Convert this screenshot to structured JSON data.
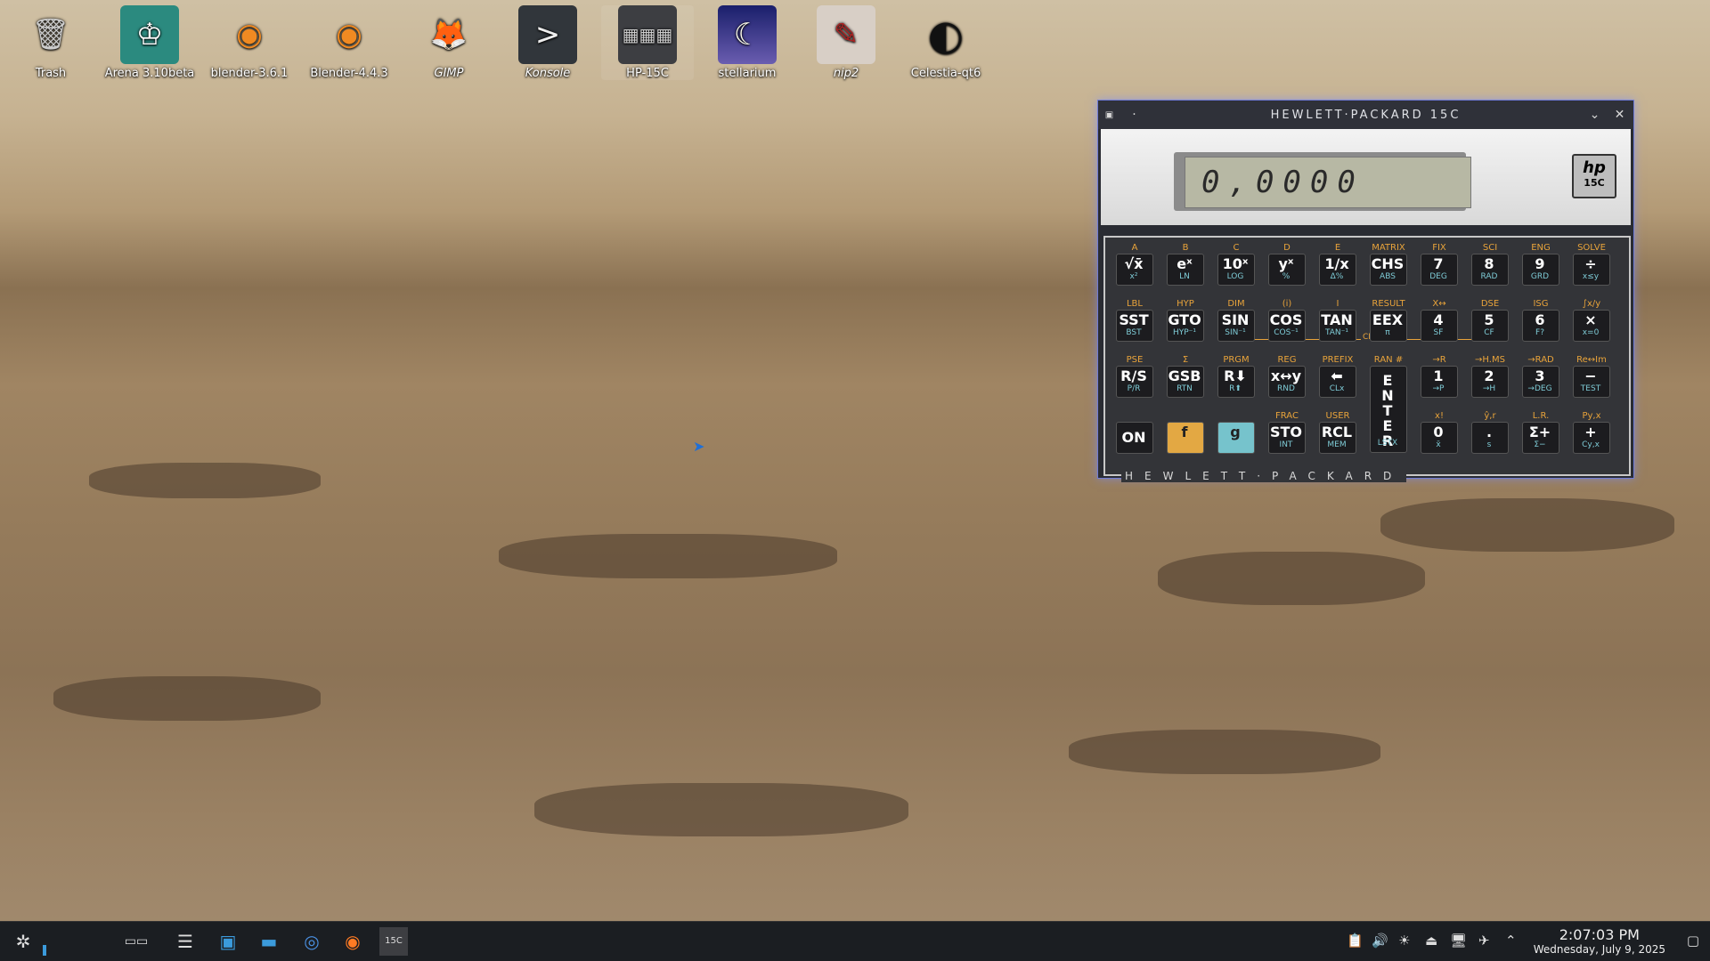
{
  "desktop": {
    "icons": [
      {
        "label": "Trash",
        "icon": "trash-icon"
      },
      {
        "label": "Arena 3.10beta",
        "icon": "chess-king-icon"
      },
      {
        "label": "blender-3.6.1",
        "icon": "blender-icon"
      },
      {
        "label": "Blender-4.4.3",
        "icon": "blender-icon"
      },
      {
        "label": "GIMP",
        "icon": "gimp-icon"
      },
      {
        "label": "Konsole",
        "icon": "terminal-icon"
      },
      {
        "label": "HP-15C",
        "icon": "calculator-icon"
      },
      {
        "label": "stellarium",
        "icon": "moon-icon"
      },
      {
        "label": "nip2",
        "icon": "image-editor-icon"
      },
      {
        "label": "Celestia-qt6",
        "icon": "celestia-icon"
      }
    ]
  },
  "window": {
    "title": "HEWLETT·PACKARD 15C",
    "display": "0,0000",
    "badge_logo": "hp",
    "badge_model": "15C",
    "brand": "HEWLETT·PACKARD"
  },
  "keys": [
    {
      "gold": "A",
      "main": "√x̄",
      "blue": "x²"
    },
    {
      "gold": "B",
      "main": "eˣ",
      "blue": "LN"
    },
    {
      "gold": "C",
      "main": "10ˣ",
      "blue": "LOG"
    },
    {
      "gold": "D",
      "main": "yˣ",
      "blue": "%"
    },
    {
      "gold": "E",
      "main": "1/x",
      "blue": "Δ%"
    },
    {
      "gold": "MATRIX",
      "main": "CHS",
      "blue": "ABS"
    },
    {
      "gold": "FIX",
      "main": "7",
      "blue": "DEG"
    },
    {
      "gold": "SCI",
      "main": "8",
      "blue": "RAD"
    },
    {
      "gold": "ENG",
      "main": "9",
      "blue": "GRD"
    },
    {
      "gold": "SOLVE",
      "main": "÷",
      "blue": "x≤y"
    },
    {
      "gold": "LBL",
      "main": "SST",
      "blue": "BST"
    },
    {
      "gold": "HYP",
      "main": "GTO",
      "blue": "HYP⁻¹"
    },
    {
      "gold": "DIM",
      "main": "SIN",
      "blue": "SIN⁻¹"
    },
    {
      "gold": "(i)",
      "main": "COS",
      "blue": "COS⁻¹"
    },
    {
      "gold": "I",
      "main": "TAN",
      "blue": "TAN⁻¹"
    },
    {
      "gold": "RESULT",
      "main": "EEX",
      "blue": "π"
    },
    {
      "gold": "X↔",
      "main": "4",
      "blue": "SF"
    },
    {
      "gold": "DSE",
      "main": "5",
      "blue": "CF"
    },
    {
      "gold": "ISG",
      "main": "6",
      "blue": "F?"
    },
    {
      "gold": "∫x/y",
      "main": "×",
      "blue": "x=0"
    },
    {
      "gold": "PSE",
      "main": "R/S",
      "blue": "P/R"
    },
    {
      "gold": "Σ",
      "main": "GSB",
      "blue": "RTN"
    },
    {
      "gold": "PRGM",
      "main": "R⬇",
      "blue": "R⬆"
    },
    {
      "gold": "REG",
      "main": "x↔y",
      "blue": "RND"
    },
    {
      "gold": "PREFIX",
      "main": "⬅",
      "blue": "CLx"
    },
    {
      "gold": "RAN #",
      "main": "ENTER",
      "blue": "LSTX"
    },
    {
      "gold": "→R",
      "main": "1",
      "blue": "→P"
    },
    {
      "gold": "→H.MS",
      "main": "2",
      "blue": "→H"
    },
    {
      "gold": "→RAD",
      "main": "3",
      "blue": "→DEG"
    },
    {
      "gold": "Re↔Im",
      "main": "−",
      "blue": "TEST"
    },
    {
      "gold": "",
      "main": "ON",
      "blue": ""
    },
    {
      "gold": "",
      "main": "f",
      "blue": ""
    },
    {
      "gold": "",
      "main": "g",
      "blue": ""
    },
    {
      "gold": "FRAC",
      "main": "STO",
      "blue": "INT"
    },
    {
      "gold": "USER",
      "main": "RCL",
      "blue": "MEM"
    },
    {
      "gold": "x!",
      "main": "0",
      "blue": "x̄"
    },
    {
      "gold": "ŷ,r",
      "main": ".",
      "blue": "s"
    },
    {
      "gold": "L.R.",
      "main": "Σ+",
      "blue": "Σ−"
    },
    {
      "gold": "Py,x",
      "main": "+",
      "blue": "Cy,x"
    }
  ],
  "clear_label": "CLEAR",
  "taskbar": {
    "time": "2:07:03 PM",
    "date": "Wednesday, July 9, 2025"
  },
  "colors": {
    "f_key": "#e3a843",
    "g_key": "#76c3cc",
    "gold_label": "#e8a33a",
    "blue_label": "#7ecbd6"
  }
}
